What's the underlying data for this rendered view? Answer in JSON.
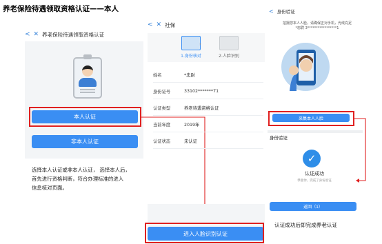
{
  "page_title": "养老保险待遇领取资格认证——本人",
  "panel1": {
    "nav_back": "<",
    "nav_close": "✕",
    "header": "养老保险待遇领取资格认证",
    "self_button": "本人认证",
    "other_button": "非本人认证",
    "description_lines": [
      "选择本人认证或非本人认证， 选择本人后，",
      "首先进行资格判断，符合办理标准的进入",
      "信息核对页面。"
    ]
  },
  "panel2": {
    "nav_back": "<",
    "nav_close": "✕",
    "header": "社保",
    "steps": [
      {
        "label": "1.身份核对",
        "active": true
      },
      {
        "label": "2.人脸识别",
        "active": false
      }
    ],
    "step_arrow": "›",
    "rows": [
      {
        "key": "姓名",
        "value": "*忠尉"
      },
      {
        "key": "身份证号",
        "value": "33102*******71"
      },
      {
        "key": "认证类型",
        "value": "养老待遇资格认证"
      },
      {
        "key": "当前年度",
        "value": "2019年"
      },
      {
        "key": "认证状态",
        "value": "未认证"
      }
    ],
    "face_button": "进入人脸识别认证"
  },
  "panel3": {
    "nav_back": "<",
    "header": "身份验证",
    "tip_line1": "拍摄您本人人脸，请确保正对手机，光线充足",
    "tip_line2": "*忠尉  3*****************1",
    "collect_button": "采集本人人脸",
    "section_title": "身份验证",
    "success_text": "认证成功",
    "success_sub": "恭喜你，完成了身份验证",
    "back_button": "返回（1）",
    "caption": "认证成功后即完成养老认证"
  },
  "colors": {
    "accent": "#3a8ef3",
    "highlight_box": "#e02020"
  },
  "icons": [
    "back-arrow-icon",
    "close-icon",
    "id-badge-icon",
    "id-card-icon",
    "face-scan-icon",
    "check-icon"
  ]
}
